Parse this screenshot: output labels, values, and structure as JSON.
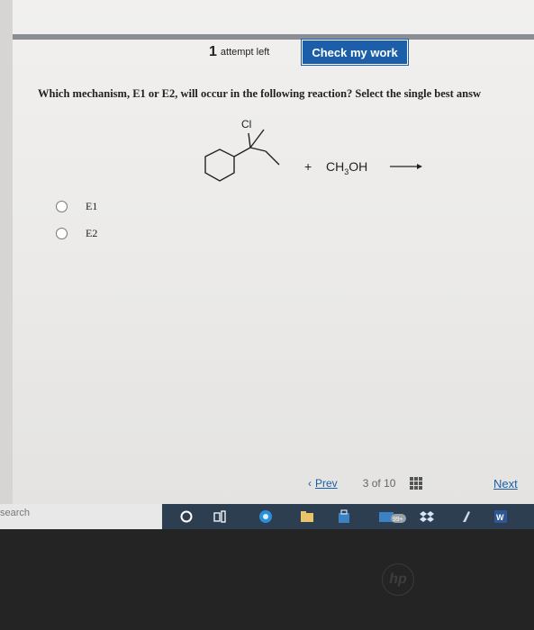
{
  "header": {
    "attempts_count": "1",
    "attempts_label": "attempt left",
    "check_button": "Check my work"
  },
  "question": {
    "text": "Which mechanism, E1 or E2, will occur in the following reaction? Select the single best answ",
    "substituent_label": "Cl",
    "plus": "+",
    "reagent_main": "CH",
    "reagent_sub": "3",
    "reagent_tail": "OH"
  },
  "options": [
    {
      "label": "E1",
      "selected": false
    },
    {
      "label": "E2",
      "selected": false
    }
  ],
  "pager": {
    "prev_label": "Prev",
    "current": "3",
    "of_label": "of",
    "total": "10",
    "next_label": "Next"
  },
  "taskbar": {
    "search_placeholder": "search",
    "badge": "99+",
    "colors": {
      "bar": "#2c3e50",
      "accent": "#1c5fa8"
    }
  },
  "device": {
    "logo": "hp"
  }
}
